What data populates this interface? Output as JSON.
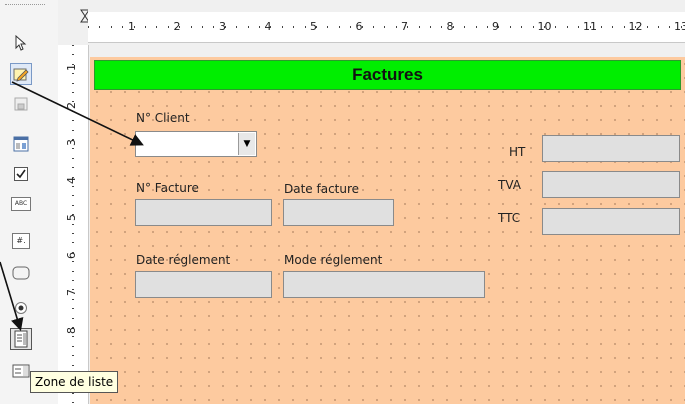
{
  "form": {
    "title": "Factures",
    "labels": {
      "client": "N° Client",
      "invoice_no": "N° Facture",
      "invoice_date": "Date facture",
      "payment_date": "Date réglement",
      "payment_mode": "Mode réglement",
      "ht": "HT",
      "tva": "TVA",
      "ttc": "TTC"
    }
  },
  "tooltip": "Zone de liste",
  "toolbar": {
    "items": [
      "select-icon",
      "design-mode-icon",
      "form-design-icon",
      "form-properties-icon",
      "checkbox-icon",
      "text-field-icon",
      "formatted-field-icon",
      "push-button-icon",
      "option-button-icon",
      "list-box-icon",
      "combo-box-icon",
      "label-field-icon"
    ],
    "abc_label": "ABC",
    "formatted_label": "#."
  },
  "ruler": {
    "h_numbers": [
      "1",
      "2",
      "3",
      "4",
      "5",
      "6",
      "7",
      "8",
      "9",
      "10",
      "11",
      "12",
      "13"
    ],
    "v_numbers": [
      "1",
      "2",
      "3",
      "4",
      "5",
      "6",
      "7",
      "8"
    ]
  },
  "colors": {
    "page_bg": "#fdca9f",
    "title_bg": "#00ee00",
    "field_bg": "#e0e0e0",
    "tooltip_bg": "#ffffe1"
  }
}
